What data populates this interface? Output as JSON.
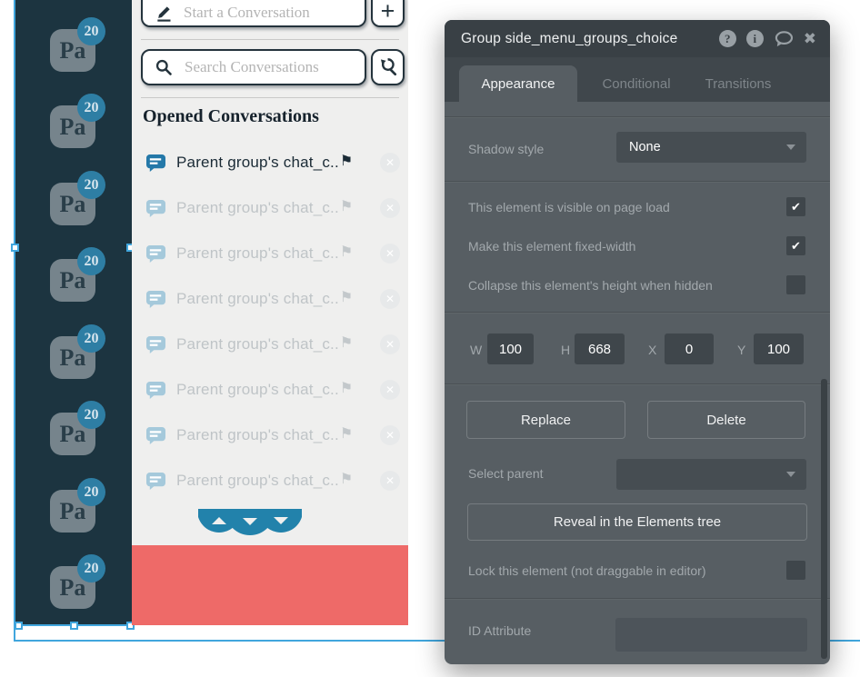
{
  "colors": {
    "guide_blue": "#41a6dd",
    "sidebar_bg": "#1c3440",
    "badge_blue": "#2e7ea4",
    "scallop_blue": "#2282ab",
    "red_block": "#ee6a68",
    "active_item_icon": "#2478a8",
    "faded_item_icon": "#a5c9db",
    "inspector_bg": "#575e63"
  },
  "sidebar": {
    "avatar_text": "Pa",
    "badge_count": "20",
    "avatar_count": 8
  },
  "conversations": {
    "compose_placeholder": "Start a Conversation",
    "add_button_label": "+",
    "search_placeholder": "Search Conversations",
    "section_title": "Opened Conversations",
    "items": [
      {
        "label": "Parent group's chat_c..",
        "active": true
      },
      {
        "label": "Parent group's chat_c..",
        "active": false
      },
      {
        "label": "Parent group's chat_c..",
        "active": false
      },
      {
        "label": "Parent group's chat_c..",
        "active": false
      },
      {
        "label": "Parent group's chat_c..",
        "active": false
      },
      {
        "label": "Parent group's chat_c..",
        "active": false
      },
      {
        "label": "Parent group's chat_c..",
        "active": false
      },
      {
        "label": "Parent group's chat_c..",
        "active": false
      }
    ]
  },
  "inspector": {
    "title": "Group side_menu_groups_choice",
    "tabs": [
      {
        "label": "Appearance",
        "active": true
      },
      {
        "label": "Conditional",
        "active": false
      },
      {
        "label": "Transitions",
        "active": false
      }
    ],
    "shadow": {
      "label": "Shadow style",
      "value": "None"
    },
    "checks": [
      {
        "label": "This element is visible on page load",
        "checked": true
      },
      {
        "label": "Make this element fixed-width",
        "checked": true
      },
      {
        "label": "Collapse this element's height when hidden",
        "checked": false
      }
    ],
    "dims": [
      {
        "label": "W",
        "value": "100"
      },
      {
        "label": "H",
        "value": "668"
      },
      {
        "label": "X",
        "value": "0"
      },
      {
        "label": "Y",
        "value": "100"
      }
    ],
    "buttons": {
      "replace": "Replace",
      "delete": "Delete",
      "reveal": "Reveal in the Elements tree"
    },
    "select_parent_label": "Select parent",
    "lock": {
      "label": "Lock this element (not draggable in editor)",
      "checked": false
    },
    "id_attribute_label": "ID Attribute"
  }
}
